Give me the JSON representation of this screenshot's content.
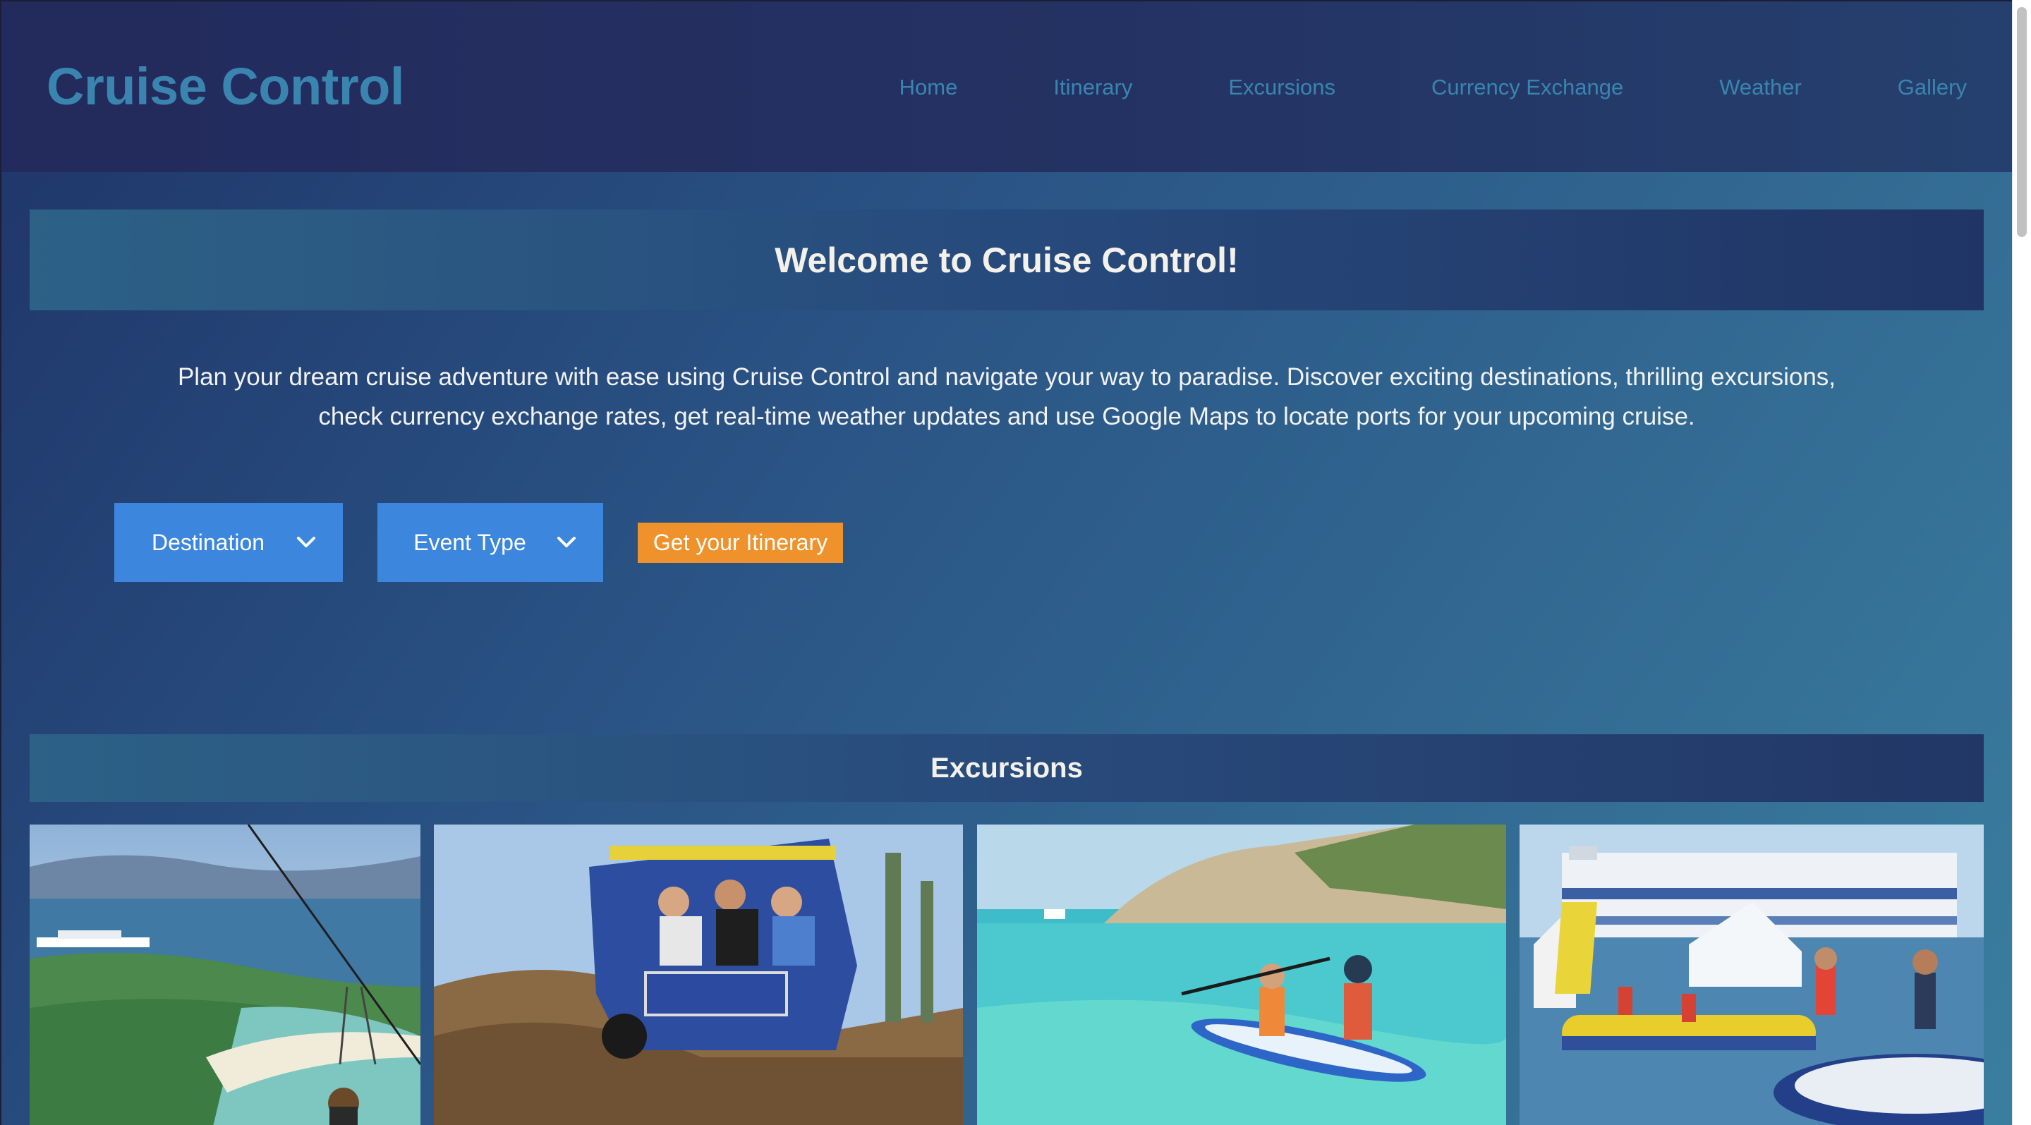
{
  "header": {
    "brand": "Cruise Control",
    "nav": [
      "Home",
      "Itinerary",
      "Excursions",
      "Currency Exchange",
      "Weather",
      "Gallery"
    ]
  },
  "welcome": {
    "title": "Welcome to Cruise Control!",
    "description": "Plan your dream cruise adventure with ease using Cruise Control and navigate your way to paradise. Discover exciting destinations, thrilling excursions, check currency exchange rates, get real-time weather updates and use Google Maps to locate ports for your upcoming cruise."
  },
  "controls": {
    "destination_label": "Destination",
    "event_type_label": "Event Type",
    "submit_label": "Get your Itinerary"
  },
  "excursions": {
    "title": "Excursions",
    "images": [
      "zipline-over-beach-photo",
      "jeep-offroad-tour-photo",
      "kayaking-turquoise-water-photo",
      "water-park-inflatables-photo"
    ]
  },
  "colors": {
    "brand_text": "#3a85b0",
    "select_bg": "#3c87dd",
    "button_bg": "#f0922b",
    "header_bg": "#232a5c"
  }
}
